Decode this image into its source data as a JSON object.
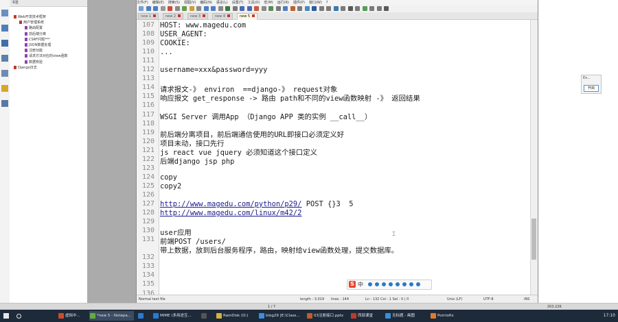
{
  "left_panel": {
    "header": "书签",
    "tree": [
      {
        "label": "Web开发技术框架",
        "indent": 0,
        "color": "#c0392b"
      },
      {
        "label": "用户管理系统",
        "indent": 1,
        "color": "#c0392b"
      },
      {
        "label": "路由配置",
        "indent": 2,
        "color": "#8e44ad"
      },
      {
        "label": "前后端分离",
        "indent": 2,
        "color": "#8e44ad"
      },
      {
        "label": "CSRF问题***",
        "indent": 2,
        "color": "#8e44ad"
      },
      {
        "label": "JSON数据处理",
        "indent": 2,
        "color": "#8e44ad"
      },
      {
        "label": "注册功能",
        "indent": 2,
        "color": "#8e44ad"
      },
      {
        "label": "请求方法对应的view函数",
        "indent": 2,
        "color": "#8e44ad"
      },
      {
        "label": "数据校验",
        "indent": 2,
        "color": "#8e44ad"
      },
      {
        "label": "Django日志",
        "indent": 0,
        "color": "#c0392b"
      }
    ]
  },
  "editor": {
    "menu": [
      "文件(F)",
      "编辑(E)",
      "搜索(S)",
      "视图(V)",
      "编码(N)",
      "语言(L)",
      "设置(T)",
      "工具(O)",
      "宏(M)",
      "运行(R)",
      "插件(P)",
      "窗口(W)",
      "?"
    ],
    "tabs": [
      "new 1",
      "new 2",
      "new 3",
      "new 4",
      "new 5"
    ],
    "active_tab": "new 5",
    "lines": [
      {
        "n": "107",
        "t": "HOST: www.magedu.com"
      },
      {
        "n": "108",
        "t": "USER_AGENT:"
      },
      {
        "n": "109",
        "t": "COOKIE:"
      },
      {
        "n": "110",
        "t": "..."
      },
      {
        "n": "111",
        "t": ""
      },
      {
        "n": "112",
        "t": "username=xxx&password=yyy"
      },
      {
        "n": "113",
        "t": ""
      },
      {
        "n": "114",
        "t": "请求报文-》 environ  ==django-》 request对象"
      },
      {
        "n": "115",
        "t": "响应报文 get_response -> 路由 path和不同的view函数映射 -》 返回结果"
      },
      {
        "n": "116",
        "t": ""
      },
      {
        "n": "117",
        "t": "WSGI Server 调用App （Django APP 类的实例 __call__）"
      },
      {
        "n": "118",
        "t": ""
      },
      {
        "n": "119",
        "t": "前后端分离项目，前后端通信使用的URL即接口必须定义好"
      },
      {
        "n": "120",
        "t": "项目未动，接口先行"
      },
      {
        "n": "121",
        "t": "js react vue jquery 必须知道这个接口定义"
      },
      {
        "n": "122",
        "t": "后端django jsp php"
      },
      {
        "n": "123",
        "t": ""
      },
      {
        "n": "124",
        "t": "copy"
      },
      {
        "n": "125",
        "t": "copy2"
      },
      {
        "n": "126",
        "t": ""
      },
      {
        "n": "127",
        "t": "http://www.magedu.com/python/p29/",
        "link": true,
        "suffix": " POST {}3  5"
      },
      {
        "n": "128",
        "t": "http://www.magedu.com/linux/m42/2",
        "link": true,
        "suffix": ""
      },
      {
        "n": "129",
        "t": ""
      },
      {
        "n": "130",
        "t": "user应用"
      },
      {
        "n": "131",
        "t": "前端POST /users/"
      },
      {
        "n": "",
        "t": "带上数据，放到后台服务程序，路由，映射给view函数处理，提交数据库。"
      },
      {
        "n": "132",
        "t": ""
      },
      {
        "n": "133",
        "t": ""
      },
      {
        "n": "134",
        "t": ""
      },
      {
        "n": "135",
        "t": ""
      },
      {
        "n": "136",
        "t": ""
      }
    ],
    "status": {
      "type": "Normal text file",
      "length": "length : 3,019",
      "lines": "lines : 144",
      "position": "Ln : 132   Col : 1   Sel : 0 | 0",
      "eol": "Unix (LF)",
      "encoding": "UTF-8",
      "mode": "INS"
    }
  },
  "ime": {
    "char": "中"
  },
  "right_widget": {
    "title": "Ex...",
    "button": "开启"
  },
  "zoom": {
    "page": "1 / 7",
    "level": "203.22K"
  },
  "taskbar": {
    "items": [
      {
        "label": "虚拟中...",
        "color": "#d04a2a"
      },
      {
        "label": "*new 5 - Notepa...",
        "color": "#5fae3c"
      },
      {
        "label": "",
        "color": "#2a7ad0"
      },
      {
        "label": "MIME (多用途互...",
        "color": "#2a7ad0"
      },
      {
        "label": "",
        "color": "#555"
      },
      {
        "label": "RamDisk (O:)",
        "color": "#d8b13a"
      },
      {
        "label": "blog29 [E:\\Class...",
        "color": "#3c8de0"
      },
      {
        "label": "03注册接口.pptx",
        "color": "#c55a2a"
      },
      {
        "label": "西部课堂",
        "color": "#c0392b"
      },
      {
        "label": "无标题 - 画图",
        "color": "#3a8fd8"
      },
      {
        "label": "Pointofix",
        "color": "#e07b2a"
      }
    ],
    "time": "17:10"
  }
}
